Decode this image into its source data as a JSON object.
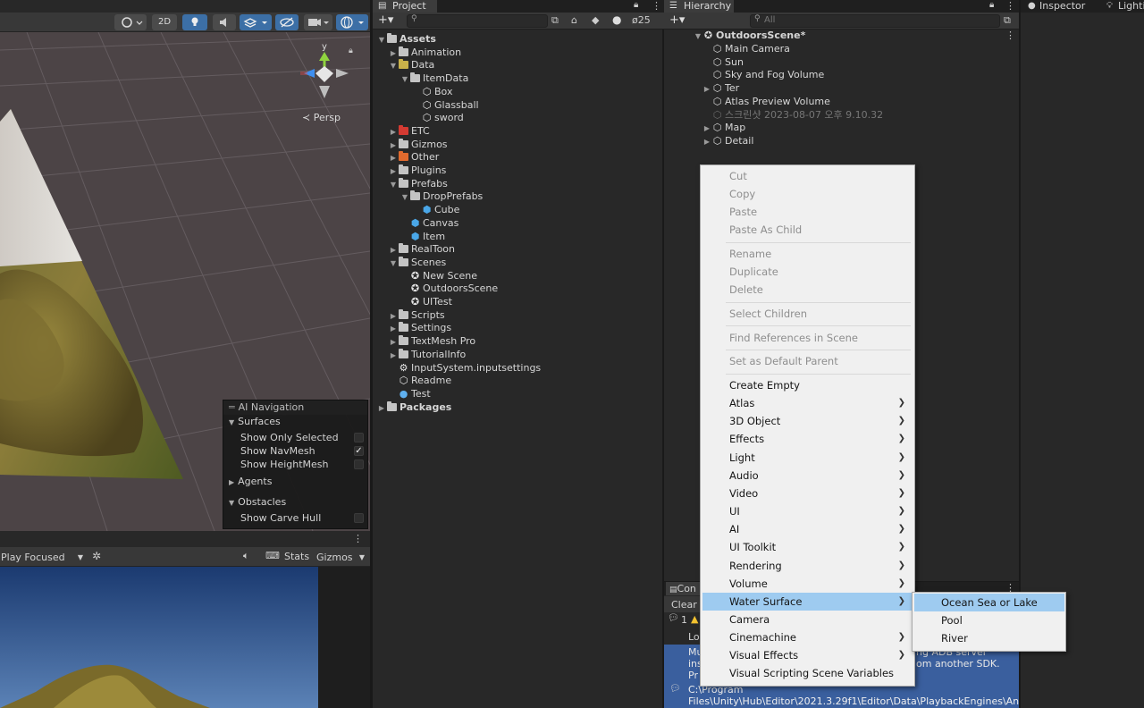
{
  "colors": {
    "accent_blue": "#3c6fa6",
    "menu_highlight": "#9ecbf0",
    "folder_yellow": "#c9b14a",
    "folder_red": "#d43a32",
    "folder_orange": "#e06a2e",
    "folder_gray": "#c4c4c4",
    "prefab_blue": "#4aa7e8"
  },
  "scene": {
    "toolbar": {
      "mode_2d": "2D"
    },
    "gizmo": {
      "y_label": "y",
      "persp_label": "≺ Persp"
    }
  },
  "ai_nav": {
    "title": "AI Navigation",
    "surfaces": "Surfaces",
    "show_only_selected": "Show Only Selected",
    "show_navmesh": "Show NavMesh",
    "show_navmesh_checked": true,
    "show_heightmesh": "Show HeightMesh",
    "agents": "Agents",
    "obstacles": "Obstacles",
    "show_carve_hull": "Show Carve Hull"
  },
  "game": {
    "play_mode": "Play Focused",
    "stats": "Stats",
    "gizmos": "Gizmos"
  },
  "project": {
    "tab": "Project",
    "hidden_count": "25",
    "tree": [
      {
        "label": "Assets",
        "depth": 0,
        "icon": "folder",
        "color": "gray",
        "arrow": "down",
        "bold": true
      },
      {
        "label": "Animation",
        "depth": 1,
        "icon": "folder",
        "color": "gray",
        "arrow": "right"
      },
      {
        "label": "Data",
        "depth": 1,
        "icon": "folder",
        "color": "yellow",
        "arrow": "down"
      },
      {
        "label": "ItemData",
        "depth": 2,
        "icon": "folder",
        "color": "gray",
        "arrow": "down"
      },
      {
        "label": "Box",
        "depth": 3,
        "icon": "scriptable",
        "arrow": "none"
      },
      {
        "label": "Glassball",
        "depth": 3,
        "icon": "scriptable",
        "arrow": "none"
      },
      {
        "label": "sword",
        "depth": 3,
        "icon": "scriptable",
        "arrow": "none"
      },
      {
        "label": "ETC",
        "depth": 1,
        "icon": "folder",
        "color": "red",
        "arrow": "right"
      },
      {
        "label": "Gizmos",
        "depth": 1,
        "icon": "folder",
        "color": "gray",
        "arrow": "right"
      },
      {
        "label": "Other",
        "depth": 1,
        "icon": "folder",
        "color": "orange",
        "arrow": "right"
      },
      {
        "label": "Plugins",
        "depth": 1,
        "icon": "folder",
        "color": "gray",
        "arrow": "right"
      },
      {
        "label": "Prefabs",
        "depth": 1,
        "icon": "folder",
        "color": "gray",
        "arrow": "down"
      },
      {
        "label": "DropPrefabs",
        "depth": 2,
        "icon": "folder",
        "color": "gray",
        "arrow": "down"
      },
      {
        "label": "Cube",
        "depth": 3,
        "icon": "prefab",
        "arrow": "none"
      },
      {
        "label": "Canvas",
        "depth": 2,
        "icon": "prefab",
        "arrow": "none"
      },
      {
        "label": "Item",
        "depth": 2,
        "icon": "prefab",
        "arrow": "none"
      },
      {
        "label": "RealToon",
        "depth": 1,
        "icon": "folder",
        "color": "gray",
        "arrow": "right"
      },
      {
        "label": "Scenes",
        "depth": 1,
        "icon": "folder",
        "color": "gray",
        "arrow": "down"
      },
      {
        "label": "New Scene",
        "depth": 2,
        "icon": "scene",
        "arrow": "none"
      },
      {
        "label": "OutdoorsScene",
        "depth": 2,
        "icon": "scene",
        "arrow": "none"
      },
      {
        "label": "UITest",
        "depth": 2,
        "icon": "scene",
        "arrow": "none"
      },
      {
        "label": "Scripts",
        "depth": 1,
        "icon": "folder",
        "color": "gray",
        "arrow": "right"
      },
      {
        "label": "Settings",
        "depth": 1,
        "icon": "folder",
        "color": "gray",
        "arrow": "right"
      },
      {
        "label": "TextMesh Pro",
        "depth": 1,
        "icon": "folder",
        "color": "gray",
        "arrow": "right"
      },
      {
        "label": "TutorialInfo",
        "depth": 1,
        "icon": "folder",
        "color": "gray",
        "arrow": "right"
      },
      {
        "label": "InputSystem.inputsettings",
        "depth": 1,
        "icon": "settings",
        "arrow": "none"
      },
      {
        "label": "Readme",
        "depth": 1,
        "icon": "scriptable",
        "arrow": "none"
      },
      {
        "label": "Test",
        "depth": 1,
        "icon": "material",
        "arrow": "none"
      },
      {
        "label": "Packages",
        "depth": 0,
        "icon": "folder",
        "color": "gray",
        "arrow": "right",
        "bold": true
      }
    ]
  },
  "hierarchy": {
    "tab": "Hierarchy",
    "search_placeholder": "All",
    "scene_name": "OutdoorsScene*",
    "items": [
      {
        "label": "Main Camera",
        "arrow": false,
        "dim": false
      },
      {
        "label": "Sun",
        "arrow": false,
        "dim": false
      },
      {
        "label": "Sky and Fog Volume",
        "arrow": false,
        "dim": false
      },
      {
        "label": "Ter",
        "arrow": true,
        "dim": false
      },
      {
        "label": "Atlas Preview Volume",
        "arrow": false,
        "dim": false
      },
      {
        "label": "스크린샷 2023-08-07 오후 9.10.32",
        "arrow": false,
        "dim": true
      },
      {
        "label": "Map",
        "arrow": true,
        "dim": false
      },
      {
        "label": "Detail",
        "arrow": true,
        "dim": false
      }
    ]
  },
  "right_tabs": {
    "inspector": "Inspector",
    "lighting": "Lighti"
  },
  "console": {
    "tab": "Con",
    "clear": "Clear",
    "count": "1",
    "col": "Lo",
    "line1": "Mu",
    "line2": "ins",
    "line3": "Pr",
    "line_partial_right1": "ng ADB server",
    "line_partial_right2": "om another SDK.",
    "path1": "C:\\Program",
    "path2": "Files\\Unity\\Hub\\Editor\\2021.3.29f1\\Editor\\Data\\PlaybackEngines\\An"
  },
  "context_menu": {
    "items": [
      {
        "label": "Cut",
        "disabled": true
      },
      {
        "label": "Copy",
        "disabled": true
      },
      {
        "label": "Paste",
        "disabled": true
      },
      {
        "label": "Paste As Child",
        "disabled": true
      },
      {
        "sep": true
      },
      {
        "label": "Rename",
        "disabled": true
      },
      {
        "label": "Duplicate",
        "disabled": true
      },
      {
        "label": "Delete",
        "disabled": true
      },
      {
        "sep": true
      },
      {
        "label": "Select Children",
        "disabled": true
      },
      {
        "sep": true
      },
      {
        "label": "Find References in Scene",
        "disabled": true
      },
      {
        "sep": true
      },
      {
        "label": "Set as Default Parent",
        "disabled": true
      },
      {
        "sep": true
      },
      {
        "label": "Create Empty",
        "disabled": false
      },
      {
        "label": "Atlas",
        "submenu": true
      },
      {
        "label": "3D Object",
        "submenu": true
      },
      {
        "label": "Effects",
        "submenu": true
      },
      {
        "label": "Light",
        "submenu": true
      },
      {
        "label": "Audio",
        "submenu": true
      },
      {
        "label": "Video",
        "submenu": true
      },
      {
        "label": "UI",
        "submenu": true
      },
      {
        "label": "AI",
        "submenu": true
      },
      {
        "label": "UI Toolkit",
        "submenu": true
      },
      {
        "label": "Rendering",
        "submenu": true
      },
      {
        "label": "Volume",
        "submenu": true
      },
      {
        "label": "Water Surface",
        "submenu": true,
        "highlighted": true
      },
      {
        "label": "Camera"
      },
      {
        "label": "Cinemachine",
        "submenu": true
      },
      {
        "label": "Visual Effects",
        "submenu": true
      },
      {
        "label": "Visual Scripting Scene Variables"
      }
    ]
  },
  "water_submenu": {
    "items": [
      {
        "label": "Ocean Sea or Lake",
        "highlighted": true
      },
      {
        "label": "Pool"
      },
      {
        "label": "River"
      }
    ]
  }
}
